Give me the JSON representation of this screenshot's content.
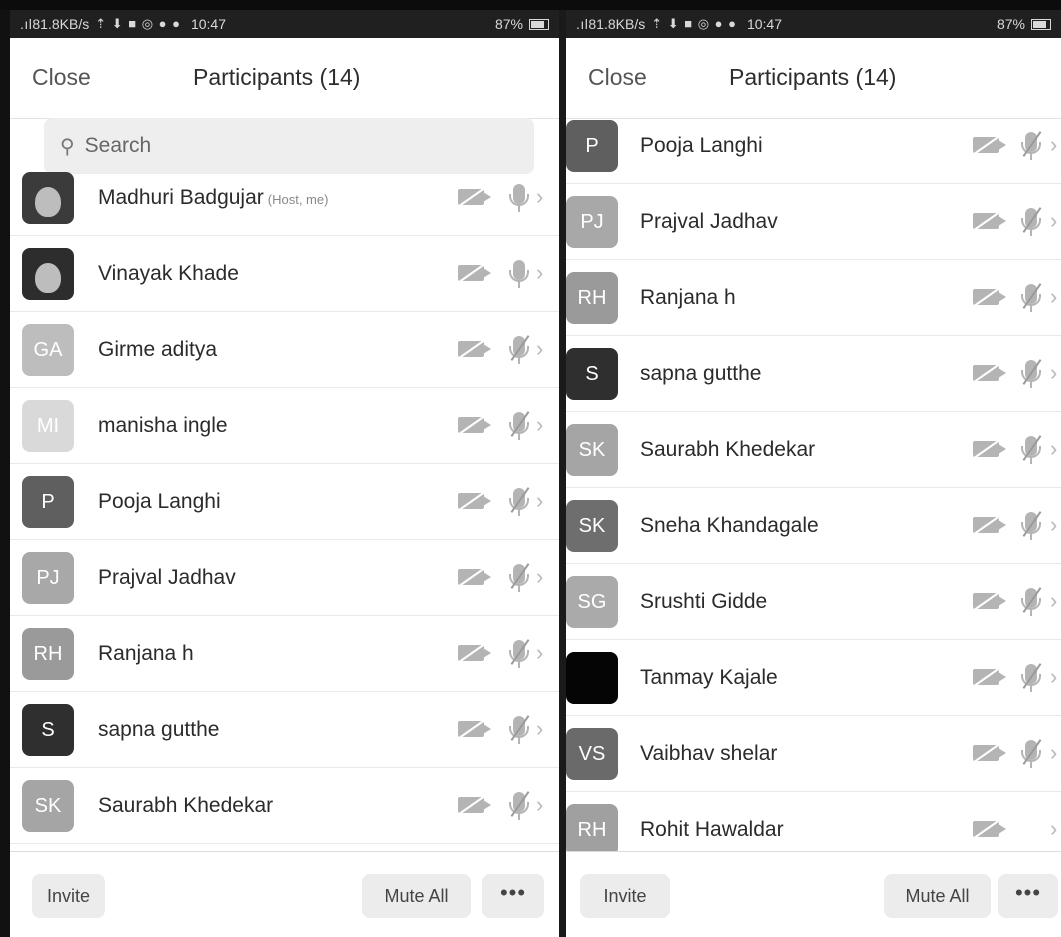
{
  "status_bar": {
    "signal": ".ıl",
    "speed": "81.8KB/s",
    "icons": "⇡ ⬇ ■ ◎ ● ●",
    "time": "10:47",
    "battery": "87%"
  },
  "panels": [
    {
      "header": {
        "close_label": "Close",
        "title": "Participants (14)"
      },
      "search": {
        "placeholder": "Search",
        "icon": "search-icon"
      },
      "participants": [
        {
          "name": "Madhuri Badgujar",
          "tag": "(Host, me)",
          "avatar": "photo",
          "initials": "",
          "color": "#3b3b3b",
          "mic": "on"
        },
        {
          "name": "Vinayak Khade",
          "tag": "",
          "avatar": "photo",
          "initials": "",
          "color": "#2d2d2d",
          "mic": "on"
        },
        {
          "name": "Girme aditya",
          "tag": "",
          "avatar": "initials",
          "initials": "GA",
          "color": "#bdbdbd",
          "mic": "muted"
        },
        {
          "name": "manisha ingle",
          "tag": "",
          "avatar": "initials",
          "initials": "MI",
          "color": "#d9d9d9",
          "mic": "muted"
        },
        {
          "name": "Pooja Langhi",
          "tag": "",
          "avatar": "initials",
          "initials": "P",
          "color": "#5f5f5f",
          "mic": "muted"
        },
        {
          "name": "Prajval Jadhav",
          "tag": "",
          "avatar": "initials",
          "initials": "PJ",
          "color": "#a8a8a8",
          "mic": "muted"
        },
        {
          "name": "Ranjana h",
          "tag": "",
          "avatar": "initials",
          "initials": "RH",
          "color": "#9a9a9a",
          "mic": "muted"
        },
        {
          "name": "sapna gutthe",
          "tag": "",
          "avatar": "initials",
          "initials": "S",
          "color": "#2f2f2f",
          "mic": "muted"
        },
        {
          "name": "Saurabh Khedekar",
          "tag": "",
          "avatar": "initials",
          "initials": "SK",
          "color": "#a5a5a5",
          "mic": "muted"
        }
      ],
      "footer": {
        "invite_label": "Invite",
        "mute_all_label": "Mute All",
        "more_label": "•••"
      }
    },
    {
      "header": {
        "close_label": "Close",
        "title": "Participants (14)"
      },
      "participants": [
        {
          "name": "Pooja Langhi",
          "tag": "",
          "avatar": "initials",
          "initials": "P",
          "color": "#5f5f5f",
          "mic": "muted"
        },
        {
          "name": "Prajval Jadhav",
          "tag": "",
          "avatar": "initials",
          "initials": "PJ",
          "color": "#a8a8a8",
          "mic": "muted"
        },
        {
          "name": "Ranjana h",
          "tag": "",
          "avatar": "initials",
          "initials": "RH",
          "color": "#9a9a9a",
          "mic": "muted"
        },
        {
          "name": "sapna gutthe",
          "tag": "",
          "avatar": "initials",
          "initials": "S",
          "color": "#2f2f2f",
          "mic": "muted"
        },
        {
          "name": "Saurabh Khedekar",
          "tag": "",
          "avatar": "initials",
          "initials": "SK",
          "color": "#a5a5a5",
          "mic": "muted"
        },
        {
          "name": "Sneha Khandagale",
          "tag": "",
          "avatar": "initials",
          "initials": "SK",
          "color": "#6e6e6e",
          "mic": "muted"
        },
        {
          "name": "Srushti Gidde",
          "tag": "",
          "avatar": "initials",
          "initials": "SG",
          "color": "#aaaaaa",
          "mic": "muted"
        },
        {
          "name": "Tanmay Kajale",
          "tag": "",
          "avatar": "initials",
          "initials": "",
          "color": "#050505",
          "mic": "muted"
        },
        {
          "name": "Vaibhav shelar",
          "tag": "",
          "avatar": "initials",
          "initials": "VS",
          "color": "#6a6a6a",
          "mic": "muted"
        },
        {
          "name": "Rohit Hawaldar",
          "tag": "",
          "avatar": "initials",
          "initials": "RH",
          "color": "#a0a0a0",
          "mic": "none"
        }
      ],
      "footer": {
        "invite_label": "Invite",
        "mute_all_label": "Mute All",
        "more_label": "•••"
      }
    }
  ]
}
